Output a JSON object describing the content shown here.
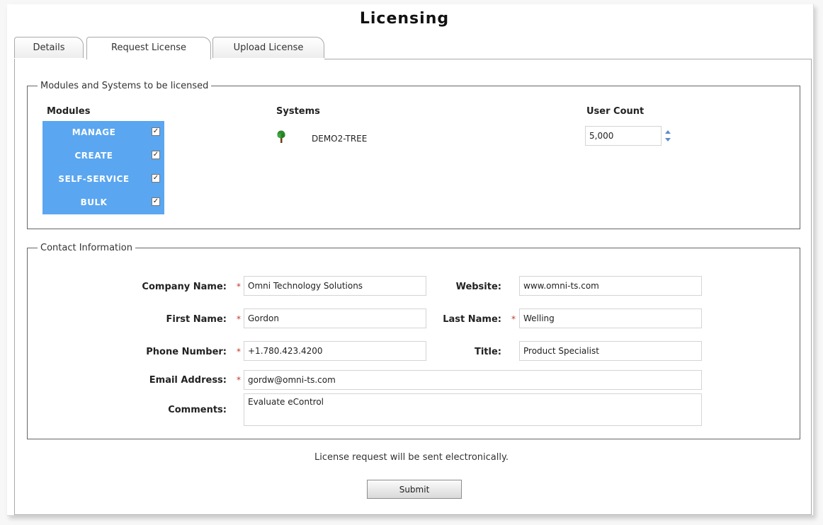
{
  "title": "Licensing",
  "tabs": [
    {
      "label": "Details",
      "active": false
    },
    {
      "label": "Request License",
      "active": true
    },
    {
      "label": "Upload License",
      "active": false
    }
  ],
  "modules_section": {
    "legend": "Modules and Systems to be licensed",
    "modules_header": "Modules",
    "systems_header": "Systems",
    "user_count_header": "User Count",
    "modules": [
      {
        "label": "MANAGE",
        "checked": true
      },
      {
        "label": "CREATE",
        "checked": true
      },
      {
        "label": "SELF-SERVICE",
        "checked": true
      },
      {
        "label": "BULK",
        "checked": true
      }
    ],
    "system": {
      "icon": "tree-icon",
      "name": "DEMO2-TREE"
    },
    "user_count": "5,000",
    "module_bg_color": "#5aa6f0"
  },
  "contact": {
    "legend": "Contact Information",
    "company_name": {
      "label": "Company Name:",
      "value": "Omni Technology Solutions",
      "required": true
    },
    "website": {
      "label": "Website:",
      "value": "www.omni-ts.com",
      "required": false
    },
    "first_name": {
      "label": "First Name:",
      "value": "Gordon",
      "required": true
    },
    "last_name": {
      "label": "Last Name:",
      "value": "Welling",
      "required": true
    },
    "phone": {
      "label": "Phone Number:",
      "value": "+1.780.423.4200",
      "required": true
    },
    "title": {
      "label": "Title:",
      "value": "Product Specialist",
      "required": false
    },
    "email": {
      "label": "Email Address:",
      "value": "gordw@omni-ts.com",
      "required": true
    },
    "comments": {
      "label": "Comments:",
      "value": "Evaluate eControl",
      "required": false
    },
    "required_marker": "*"
  },
  "footer": {
    "note": "License request will be sent electronically.",
    "submit_label": "Submit"
  }
}
